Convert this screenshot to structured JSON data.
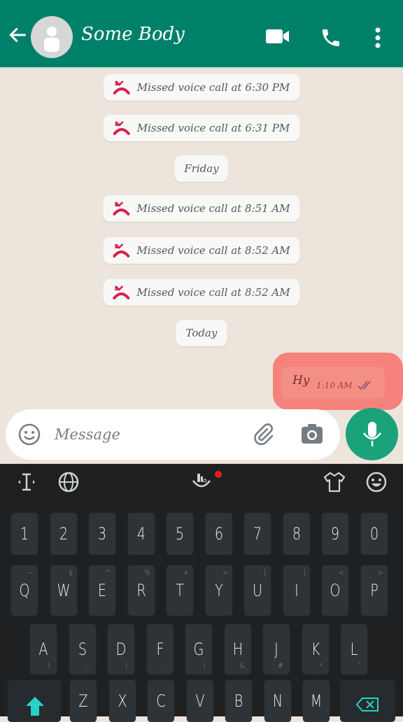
{
  "header": {
    "contact_name": "Some Body",
    "icons": [
      "back-arrow-icon",
      "avatar-icon",
      "video-call-icon",
      "phone-icon",
      "more-vert-icon"
    ],
    "color": "#008069"
  },
  "chat": {
    "items": [
      {
        "type": "missed",
        "text": "Missed voice call at 6:30 PM"
      },
      {
        "type": "missed",
        "text": "Missed voice call at 6:31 PM"
      },
      {
        "type": "date",
        "text": "Friday"
      },
      {
        "type": "missed",
        "text": "Missed voice call at 8:51 AM"
      },
      {
        "type": "missed",
        "text": "Missed voice call at 8:52 AM"
      },
      {
        "type": "missed",
        "text": "Missed voice call at 8:52 AM"
      },
      {
        "type": "date",
        "text": "Today"
      }
    ],
    "outgoing": {
      "text": "Hy",
      "time": "1:10 AM",
      "status": "read",
      "highlight_color": "#f5837b"
    }
  },
  "composer": {
    "placeholder": "Message",
    "icons": [
      "emoji-icon",
      "attach-icon",
      "camera-icon",
      "mic-icon"
    ]
  },
  "keyboard": {
    "toolbar_icons": [
      "cursor-icon",
      "globe-icon",
      "typing-logo-icon",
      "theme-icon",
      "emoji-icon"
    ],
    "rows": [
      [
        [
          "1",
          ""
        ],
        [
          "2",
          ""
        ],
        [
          "3",
          ""
        ],
        [
          "4",
          ""
        ],
        [
          "5",
          ""
        ],
        [
          "6",
          ""
        ],
        [
          "7",
          ""
        ],
        [
          "8",
          ""
        ],
        [
          "9",
          ""
        ],
        [
          "0",
          ""
        ]
      ],
      [
        [
          "Q",
          "~"
        ],
        [
          "W",
          "$"
        ],
        [
          "E",
          "^"
        ],
        [
          "R",
          "%"
        ],
        [
          "T",
          "+"
        ],
        [
          "Y",
          "="
        ],
        [
          "U",
          "["
        ],
        [
          "I",
          "]"
        ],
        [
          "O",
          "<"
        ],
        [
          "P",
          ">"
        ]
      ],
      [
        [
          "A",
          "\\"
        ],
        [
          "S",
          "_"
        ],
        [
          "D",
          "("
        ],
        [
          "F",
          ";"
        ],
        [
          "G",
          ")"
        ],
        [
          "H",
          "&"
        ],
        [
          "J",
          "#"
        ],
        [
          "K",
          "*"
        ],
        [
          "L",
          "\""
        ]
      ],
      [
        [
          "Z",
          ""
        ],
        [
          "X",
          ""
        ],
        [
          "C",
          ""
        ],
        [
          "V",
          ""
        ],
        [
          "B",
          ""
        ],
        [
          "N",
          ""
        ],
        [
          "M",
          ""
        ]
      ]
    ]
  }
}
